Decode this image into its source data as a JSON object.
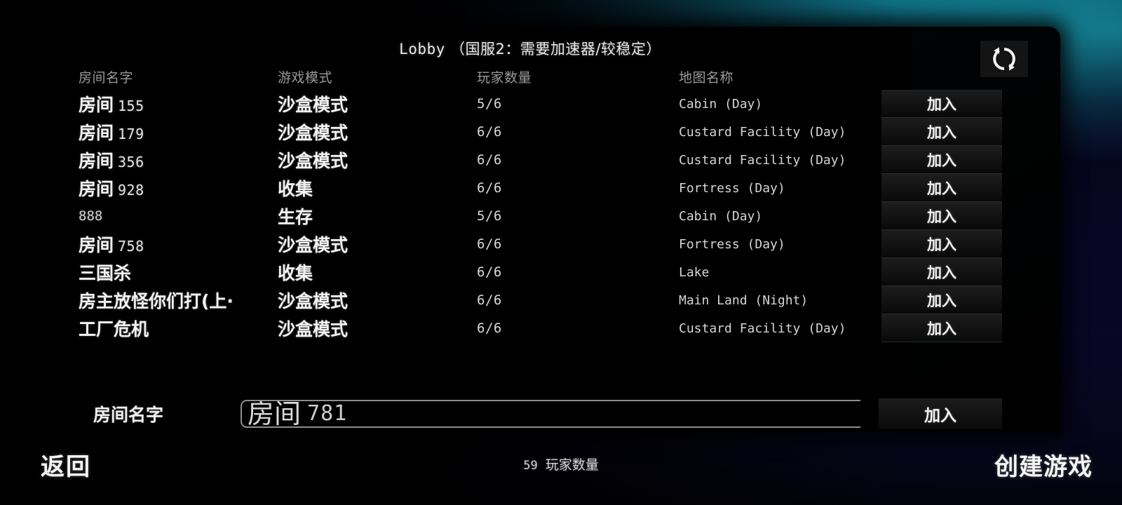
{
  "window": {
    "title_latin": "Lobby",
    "title_cn": "（国服2：需要加速器/较稳定）"
  },
  "icons": {
    "refresh": "refresh-icon"
  },
  "table": {
    "headers": {
      "name": "房间名字",
      "mode": "游戏模式",
      "count": "玩家数量",
      "map": "地图名称"
    },
    "join_label": "加入",
    "rows": [
      {
        "name_cn": "房间",
        "name_num": "155",
        "mode": "沙盒模式",
        "count": "5/6",
        "map": "Cabin (Day)"
      },
      {
        "name_cn": "房间",
        "name_num": "179",
        "mode": "沙盒模式",
        "count": "6/6",
        "map": "Custard Facility (Day)"
      },
      {
        "name_cn": "房间",
        "name_num": "356",
        "mode": "沙盒模式",
        "count": "6/6",
        "map": "Custard Facility (Day)"
      },
      {
        "name_cn": "房间",
        "name_num": "928",
        "mode": "收集",
        "count": "6/6",
        "map": "Fortress (Day)"
      },
      {
        "name_cn": "",
        "name_num": "888",
        "mode": "生存",
        "count": "5/6",
        "map": "Cabin (Day)"
      },
      {
        "name_cn": "房间",
        "name_num": "758",
        "mode": "沙盒模式",
        "count": "6/6",
        "map": "Fortress (Day)"
      },
      {
        "name_cn": "三国杀",
        "name_num": "",
        "mode": "收集",
        "count": "6/6",
        "map": "Lake"
      },
      {
        "name_cn": "房主放怪你们打(上·",
        "name_num": "",
        "mode": "沙盒模式",
        "count": "6/6",
        "map": "Main Land (Night)"
      },
      {
        "name_cn": "工厂危机",
        "name_num": "",
        "mode": "沙盒模式",
        "count": "6/6",
        "map": "Custard Facility (Day)"
      }
    ]
  },
  "create_room": {
    "label": "房间名字",
    "input_cn": "房间",
    "input_num": "781",
    "join_label": "加入"
  },
  "bottom_bar": {
    "back_label": "返回",
    "player_count": "59",
    "player_count_label": "玩家数量",
    "create_game_label": "创建游戏"
  },
  "colors": {
    "accent_teal": "#12a0b5",
    "background_navy": "#0b0b36",
    "panel_black": "#000000",
    "text_primary": "#f2f2f2",
    "text_muted": "#9a9a9a",
    "button_fill": "#151515"
  }
}
